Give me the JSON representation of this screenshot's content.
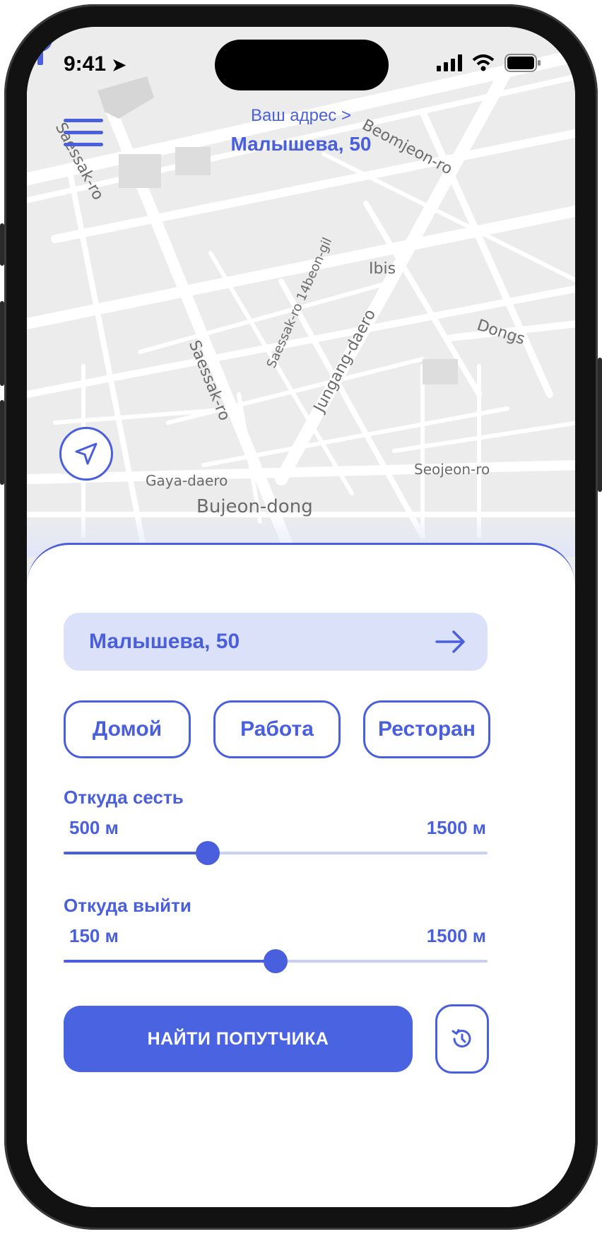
{
  "status_bar": {
    "time": "9:41"
  },
  "header": {
    "address_link": "Ваш адрес >",
    "address_title": "Малышева, 50"
  },
  "map": {
    "labels": [
      "Saessak-ro",
      "Beomjeon-ro",
      "Ibis",
      "Saessak-ro 14beon-gil",
      "Dongs",
      "Saessak-ro",
      "Jungang-daero",
      "Seojeon-ro",
      "Gaya-daero",
      "Bujeon-dong"
    ]
  },
  "sheet": {
    "search_value": "Малышева, 50",
    "chips": [
      "Домой",
      "Работа",
      "Ресторан"
    ],
    "slider_from": {
      "title": "Откуда сесть",
      "min_label": "500 м",
      "max_label": "1500 м",
      "value_fraction": 0.34
    },
    "slider_to": {
      "title": "Откуда выйти",
      "min_label": "150 м",
      "max_label": "1500 м",
      "value_fraction": 0.5
    },
    "find_button": "НАЙТИ ПОПУТЧИКА"
  },
  "colors": {
    "accent": "#4a5fdd",
    "accent_light": "#dce1fa",
    "map_bg": "#ececec"
  },
  "icons": [
    "menu-icon",
    "location-arrow-icon",
    "map-pin-icon",
    "arrow-right-icon",
    "history-icon",
    "signal-icon",
    "wifi-icon",
    "battery-icon"
  ]
}
